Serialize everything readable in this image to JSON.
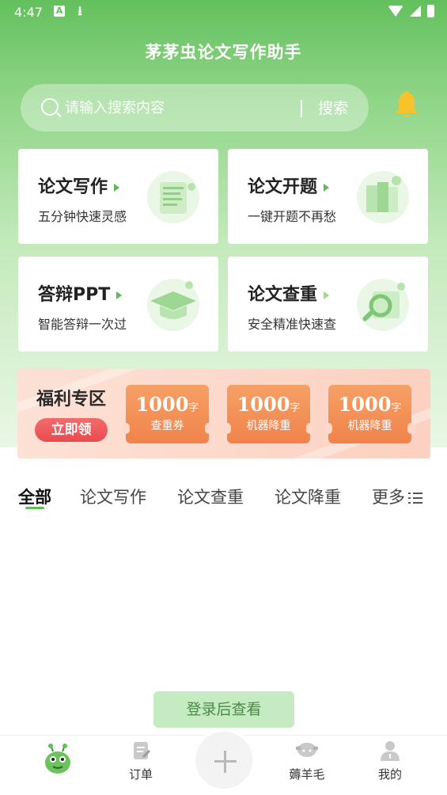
{
  "status_bar": {
    "time": "4:47"
  },
  "header": {
    "title": "茅茅虫论文写作助手"
  },
  "search": {
    "placeholder": "请输入搜索内容",
    "button_label": "搜索"
  },
  "features": [
    {
      "title": "论文写作",
      "subtitle": "五分钟快速灵感"
    },
    {
      "title": "论文开题",
      "subtitle": "一键开题不再愁"
    },
    {
      "title": "答辩PPT",
      "subtitle": "智能答辩一次过"
    },
    {
      "title": "论文查重",
      "subtitle": "安全精准快速查"
    }
  ],
  "welfare": {
    "title": "福利专区",
    "claim_label": "立即领",
    "coupons": [
      {
        "amount": "1000",
        "unit": "字",
        "label": "查重券"
      },
      {
        "amount": "1000",
        "unit": "字",
        "label": "机器降重"
      },
      {
        "amount": "1000",
        "unit": "字",
        "label": "机器降重"
      }
    ]
  },
  "tabs": [
    "全部",
    "论文写作",
    "论文查重",
    "论文降重",
    "更多"
  ],
  "login_prompt": "登录后查看",
  "bottom_nav": {
    "orders": "订单",
    "wool": "薅羊毛",
    "mine": "我的"
  },
  "colors": {
    "brand_green": "#5fbf5a",
    "coupon_orange": "#f0834b",
    "claim_red": "#e84b4f"
  }
}
